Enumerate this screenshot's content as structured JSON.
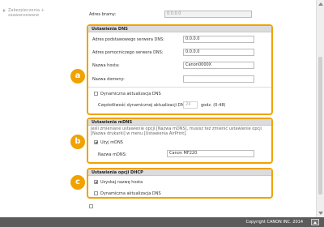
{
  "sidebar": {
    "link_label": "Zabezpieczenia + zaawansowane"
  },
  "top": {
    "gateway_label": "Adres bramy:",
    "gateway_value": "0.0.0.0"
  },
  "dns": {
    "header": "Ustawienia DNS",
    "primary_label": "Adres podstawowego serwera DNS:",
    "primary_value": "0.0.0.0",
    "secondary_label": "Adres pomocniczego serwera DNS:",
    "secondary_value": "0.0.0.0",
    "host_label": "Nazwa hosta:",
    "host_value": "Canon0000X",
    "domain_label": "Nazwa domeny:",
    "domain_value": "",
    "dynamic_label": "Dynamiczna aktualizacja DNS",
    "frequency_label": "Częstotliwość dynamicznej aktualizacji DNS:",
    "frequency_value": "24",
    "frequency_unit": "godz. (0-48)",
    "marker": "a"
  },
  "mdns": {
    "header": "Ustawienia mDNS",
    "note": "Jeśli zmieniane ustawienie opcji [Nazwa mDNS], musisz też zmienić ustawienie opcji [Nazwa drukarki] w menu [Ustawienia AirPrint].",
    "use_label": "Użyj mDNS",
    "name_label": "Nazwa mDNS:",
    "name_value": "Canon MF220",
    "marker": "b"
  },
  "dhcp": {
    "header": "Ustawienia opcji DHCP",
    "host_label": "Uzyskaj nazwę hosta",
    "dns_update_label": "Dynamiczna aktualizacja DNS",
    "marker": "c"
  },
  "footer": {
    "copyright": "Copyright CANON INC. 2014"
  },
  "colors": {
    "accent": "#f0a200",
    "section_header": "#dcdcdc",
    "footer": "#5b5b5b"
  }
}
